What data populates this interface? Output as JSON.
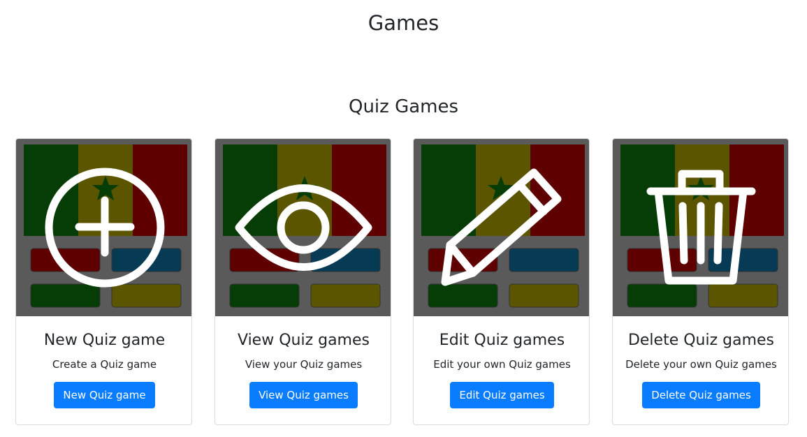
{
  "header": {
    "title": "Games"
  },
  "section": {
    "title": "Quiz Games"
  },
  "colors": {
    "button": "#0a7cff",
    "flag_green": "#063d06",
    "flag_yellow": "#5c5500",
    "flag_red": "#5e0000",
    "answer_blue": "#073a55"
  },
  "cards": [
    {
      "icon": "plus-circle-icon",
      "title": "New Quiz game",
      "text": "Create a Quiz game",
      "button": "New Quiz game"
    },
    {
      "icon": "eye-icon",
      "title": "View Quiz games",
      "text": "View your Quiz games",
      "button": "View Quiz games"
    },
    {
      "icon": "pencil-icon",
      "title": "Edit Quiz games",
      "text": "Edit your own Quiz games",
      "button": "Edit Quiz games"
    },
    {
      "icon": "trash-icon",
      "title": "Delete Quiz games",
      "text": "Delete your own Quiz games",
      "button": "Delete Quiz games"
    }
  ]
}
